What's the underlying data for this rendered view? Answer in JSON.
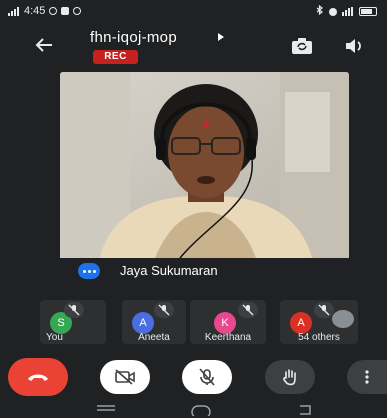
{
  "status_bar": {
    "time": "4:45",
    "signal_icon": "signal-icon",
    "battery_icon": "battery-icon"
  },
  "header": {
    "meeting_code": "fhn-iqoj-mop",
    "rec_badge": "REC",
    "back_icon": "arrow-back-icon",
    "switch_camera_icon": "switch-camera-icon",
    "speaker_icon": "volume-icon"
  },
  "main_video": {
    "speaker_name": "Jaya Sukumaran",
    "audio_indicator_color": "#1a73e8"
  },
  "participants": [
    {
      "initial": "S",
      "name": "You",
      "avatar_color": "#34a853",
      "muted": true
    },
    {
      "initial": "A",
      "name": "Aneeta",
      "avatar_color": "#4a6ee0",
      "muted": true
    },
    {
      "initial": "K",
      "name": "Keerthana",
      "avatar_color": "#e8488e",
      "muted": true
    },
    {
      "initial": "A",
      "name": "54 others",
      "avatar_color": "#d93025",
      "muted": true
    }
  ],
  "controls": {
    "end_call_color": "#ea4335",
    "end_call_icon": "end-call-icon",
    "camera_icon": "camera-off-icon",
    "mic_icon": "mic-off-icon",
    "raise_hand_icon": "raise-hand-icon",
    "more_icon": "more-vert-icon"
  },
  "nav_bar": {
    "icons": [
      "recents-icon",
      "home-icon",
      "back-nav-icon"
    ]
  }
}
